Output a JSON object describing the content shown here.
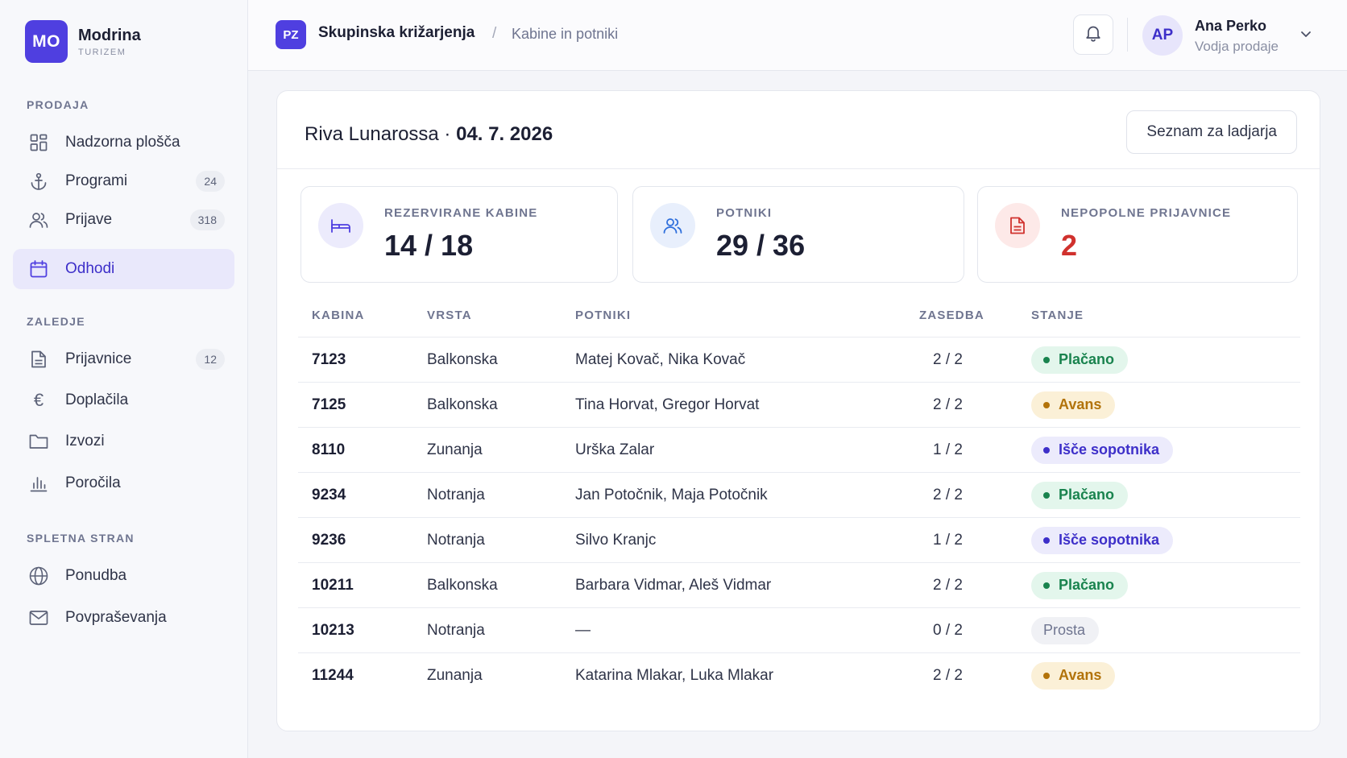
{
  "brand": {
    "logo": "MO",
    "name": "Modrina",
    "sub": "TURIZEM"
  },
  "sidebar": {
    "sections": [
      {
        "title": "PRODAJA"
      },
      {
        "title": "ZALEDJE"
      },
      {
        "title": "SPLETNA STRAN"
      }
    ],
    "items": [
      {
        "label": "Nadzorna plošča",
        "icon": "dashboard-icon"
      },
      {
        "label": "Programi",
        "icon": "anchor-icon",
        "count": "24"
      },
      {
        "label": "Prijave",
        "icon": "users-icon",
        "count": "318"
      },
      {
        "label": "Odhodi",
        "icon": "calendar-icon",
        "active": true
      },
      {
        "label": "Prijavnice",
        "icon": "document-icon",
        "count": "12"
      },
      {
        "label": "Doplačila",
        "icon": "euro-icon"
      },
      {
        "label": "Izvozi",
        "icon": "folder-icon"
      },
      {
        "label": "Poročila",
        "icon": "bar-chart-icon"
      },
      {
        "label": "Ponudba",
        "icon": "globe-icon"
      },
      {
        "label": "Povpraševanja",
        "icon": "mail-icon"
      }
    ]
  },
  "header": {
    "badge": "PZ",
    "title": "Skupinska križarjenja",
    "separator": "/",
    "subtitle": "Kabine in potniki",
    "user": {
      "initials": "AP",
      "name": "Ana Perko",
      "role": "Vodja prodaje"
    }
  },
  "card": {
    "title_ship": "Riva Lunarossa · ",
    "title_date": "04. 7. 2026",
    "manifest_button": "Seznam za ladjarja"
  },
  "stats": [
    {
      "label": "REZERVIRANE KABINE",
      "value": "14 / 18",
      "icon": "bed-icon",
      "accent": "#4f3fe0",
      "bg": "#ecebfc"
    },
    {
      "label": "POTNIKI",
      "value": "29 / 36",
      "icon": "users-icon",
      "accent": "#2f6fdc",
      "bg": "#e8effc"
    },
    {
      "label": "NEPOPOLNE PRIJAVNICE",
      "value": "2",
      "icon": "document-icon",
      "accent": "#d0312d",
      "bg": "#fde9e8",
      "value_color": "#d0312d"
    }
  ],
  "table": {
    "headers": {
      "cabin": "KABINA",
      "type": "VRSTA",
      "passengers": "POTNIKI",
      "occupancy": "ZASEDBA",
      "status": "STANJE"
    },
    "rows": [
      {
        "cabin": "7123",
        "type": "Balkonska",
        "passengers": "Matej Kovač, Nika Kovač",
        "occupancy": "2 / 2",
        "status": "Plačano",
        "kind": "paid"
      },
      {
        "cabin": "7125",
        "type": "Balkonska",
        "passengers": "Tina Horvat, Gregor Horvat",
        "occupancy": "2 / 2",
        "status": "Avans",
        "kind": "dep"
      },
      {
        "cabin": "8110",
        "type": "Zunanja",
        "passengers": "Urška Zalar",
        "occupancy": "1 / 2",
        "status": "Išče sopotnika",
        "kind": "seek"
      },
      {
        "cabin": "9234",
        "type": "Notranja",
        "passengers": "Jan Potočnik, Maja Potočnik",
        "occupancy": "2 / 2",
        "status": "Plačano",
        "kind": "paid"
      },
      {
        "cabin": "9236",
        "type": "Notranja",
        "passengers": "Silvo Kranjc",
        "occupancy": "1 / 2",
        "status": "Išče sopotnika",
        "kind": "seek"
      },
      {
        "cabin": "10211",
        "type": "Balkonska",
        "passengers": "Barbara Vidmar, Aleš Vidmar",
        "occupancy": "2 / 2",
        "status": "Plačano",
        "kind": "paid"
      },
      {
        "cabin": "10213",
        "type": "Notranja",
        "passengers": "—",
        "occupancy": "0 / 2",
        "status": "Prosta",
        "kind": "free"
      },
      {
        "cabin": "11244",
        "type": "Zunanja",
        "passengers": "Katarina Mlakar, Luka Mlakar",
        "occupancy": "2 / 2",
        "status": "Avans",
        "kind": "dep"
      }
    ]
  }
}
